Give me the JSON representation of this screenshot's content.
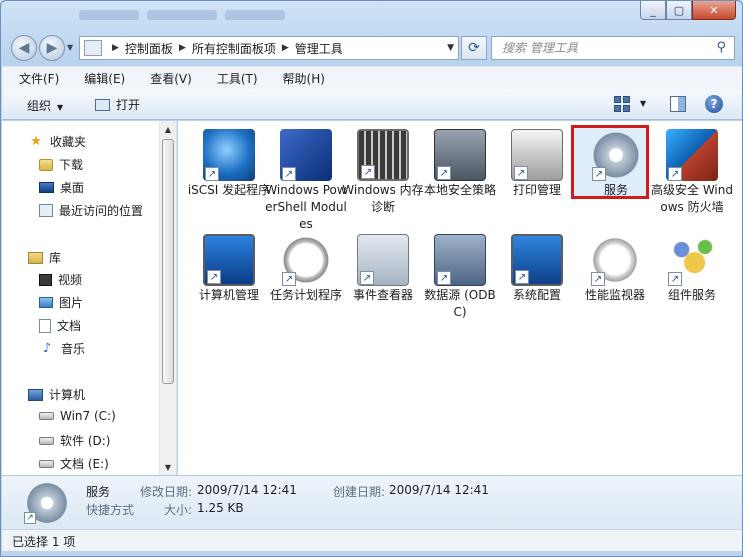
{
  "window": {
    "minimize_icon": "minimize-icon",
    "maximize_icon": "maximize-icon",
    "close_icon": "close-icon"
  },
  "address": {
    "breadcrumbs": [
      "控制面板",
      "所有控制面板项",
      "管理工具"
    ],
    "search_placeholder": "搜索 管理工具"
  },
  "menu": [
    "文件(F)",
    "编辑(E)",
    "查看(V)",
    "工具(T)",
    "帮助(H)"
  ],
  "toolbar": {
    "organize": "组织",
    "open": "打开"
  },
  "nav": {
    "favorites": "收藏夹",
    "downloads": "下载",
    "desktop": "桌面",
    "recent": "最近访问的位置",
    "libraries": "库",
    "videos": "视频",
    "pictures": "图片",
    "documents": "文档",
    "music": "音乐",
    "computer": "计算机",
    "drive_c": "Win7 (C:)",
    "drive_d": "软件 (D:)",
    "drive_e": "文档 (E:)"
  },
  "items": [
    {
      "label": "iSCSI 发起程序",
      "icon": "iscsi-initiator-icon"
    },
    {
      "label": "Windows PowerShell Modules",
      "icon": "powershell-icon"
    },
    {
      "label": "Windows 内存诊断",
      "icon": "memory-diagnostic-icon"
    },
    {
      "label": "本地安全策略",
      "icon": "local-security-policy-icon"
    },
    {
      "label": "打印管理",
      "icon": "print-management-icon"
    },
    {
      "label": "服务",
      "icon": "services-icon",
      "selected": true
    },
    {
      "label": "高级安全 Windows 防火墙",
      "icon": "firewall-icon"
    },
    {
      "label": "计算机管理",
      "icon": "computer-management-icon"
    },
    {
      "label": "任务计划程序",
      "icon": "task-scheduler-icon"
    },
    {
      "label": "事件查看器",
      "icon": "event-viewer-icon"
    },
    {
      "label": "数据源 (ODBC)",
      "icon": "odbc-icon"
    },
    {
      "label": "系统配置",
      "icon": "system-config-icon"
    },
    {
      "label": "性能监视器",
      "icon": "performance-monitor-icon"
    },
    {
      "label": "组件服务",
      "icon": "component-services-icon"
    }
  ],
  "details": {
    "name": "服务",
    "type": "快捷方式",
    "modified_label": "修改日期:",
    "modified_value": "2009/7/14 12:41",
    "size_label": "大小:",
    "size_value": "1.25 KB",
    "created_label": "创建日期:",
    "created_value": "2009/7/14 12:41"
  },
  "status": "已选择 1 项",
  "colors": {
    "selection_border": "#d31b1b",
    "window_frame": "#bcd5ef"
  }
}
